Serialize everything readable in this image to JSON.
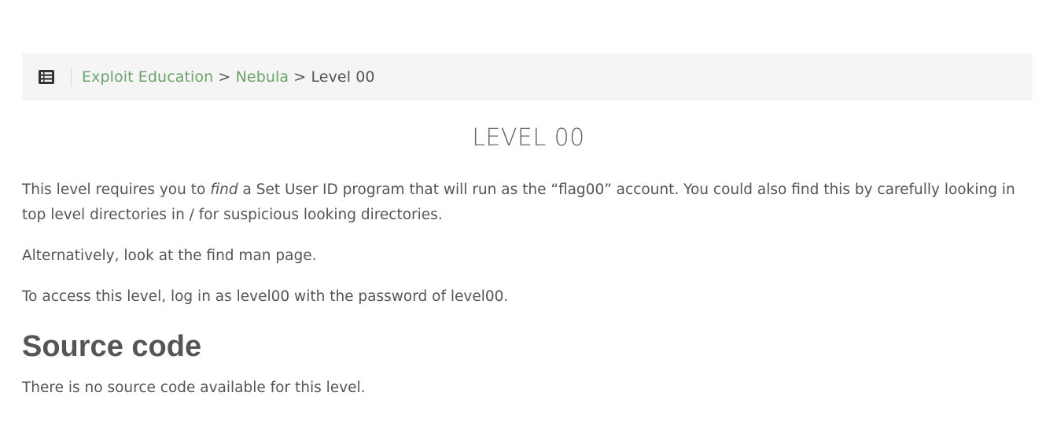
{
  "breadcrumb": {
    "menu_icon": "list-icon",
    "items": [
      {
        "label": "Exploit Education",
        "link": true
      },
      {
        "label": "Nebula",
        "link": true
      },
      {
        "label": "Level 00",
        "link": false
      }
    ],
    "separator": ">"
  },
  "page": {
    "title": "LEVEL 00",
    "intro_before": "This level requires you to ",
    "intro_em": "find",
    "intro_after": " a Set User ID program that will run as the “flag00” account. You could also find this by carefully looking in top level directories in / for suspicious looking directories.",
    "alt_text": "Alternatively, look at the find man page.",
    "access_text": "To access this level, log in as level00 with the password of level00."
  },
  "source": {
    "heading": "Source code",
    "text": "There is no source code available for this level."
  },
  "colors": {
    "link": "#6aa36a",
    "text": "#555555",
    "breadcrumb_bg": "#f5f5f5"
  }
}
